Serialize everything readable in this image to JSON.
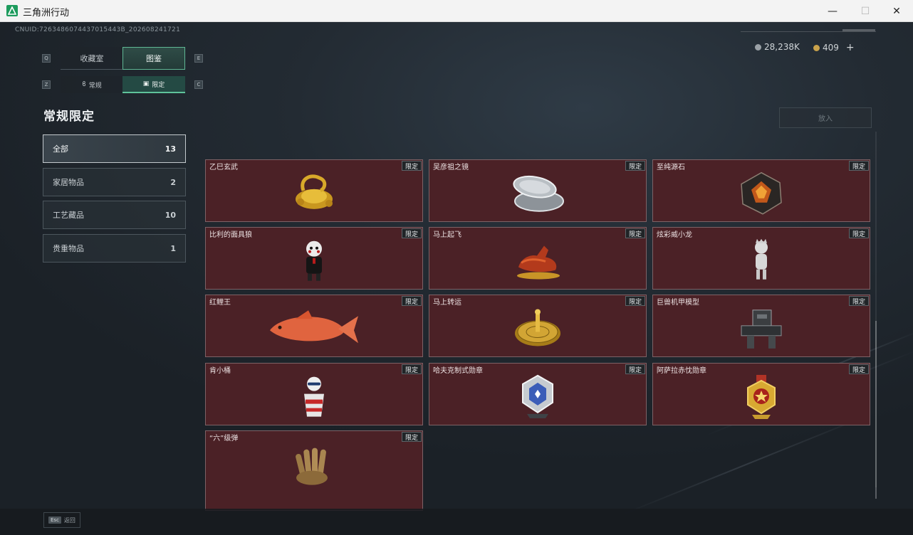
{
  "window": {
    "title": "三角洲行动",
    "minimize_icon": "—",
    "maximize_icon": "☐",
    "close_icon": "✕"
  },
  "header": {
    "uid": "CNUID:7263486074437015443B_202608241721",
    "currency": [
      {
        "value": "28,238K",
        "icon": "silver-coin-icon"
      },
      {
        "value": "409",
        "icon": "gold-coin-icon",
        "plus": "+"
      }
    ]
  },
  "tabs": {
    "left_key": "Q",
    "right_key": "E",
    "items": [
      {
        "label": "收藏室",
        "active": false
      },
      {
        "label": "图鉴",
        "active": true
      }
    ]
  },
  "subtabs": {
    "left_key": "Z",
    "right_key": "C",
    "items": [
      {
        "label": "常规",
        "icon": "flame-icon",
        "active": false
      },
      {
        "label": "限定",
        "icon": "frame-icon",
        "active": true
      }
    ]
  },
  "section_title": "常规限定",
  "categories": [
    {
      "label": "全部",
      "count": "13",
      "active": true
    },
    {
      "label": "家居物品",
      "count": "2",
      "active": false
    },
    {
      "label": "工艺藏品",
      "count": "10",
      "active": false
    },
    {
      "label": "贵重物品",
      "count": "1",
      "active": false
    }
  ],
  "put_button": "放入",
  "badge_label": "限定",
  "items": [
    {
      "name": "乙巳玄武",
      "art": "golden-turtle"
    },
    {
      "name": "吴彦祖之镜",
      "art": "compact-mirror"
    },
    {
      "name": "至纯源石",
      "art": "dark-crystal"
    },
    {
      "name": "比利的面具狼",
      "art": "puppet-doll"
    },
    {
      "name": "马上起飞",
      "art": "red-horse"
    },
    {
      "name": "炫彩威小龙",
      "art": "white-figurine"
    },
    {
      "name": "红鲤王",
      "art": "red-carp"
    },
    {
      "name": "马上转运",
      "art": "golden-compass"
    },
    {
      "name": "巨兽机甲模型",
      "art": "mech-model"
    },
    {
      "name": "肯小桶",
      "art": "bucket-figure"
    },
    {
      "name": "哈夫克制式勋章",
      "art": "silver-medal"
    },
    {
      "name": "阿萨拉赤忱勋章",
      "art": "gold-medal"
    },
    {
      "name": "“六”级弹",
      "art": "bullet-hand"
    }
  ],
  "footer": {
    "esc_key": "Esc",
    "back_label": "返回"
  },
  "colors": {
    "card_bg": "#4b2126",
    "accent": "#5fc39a",
    "active_tab": "#244a44"
  }
}
